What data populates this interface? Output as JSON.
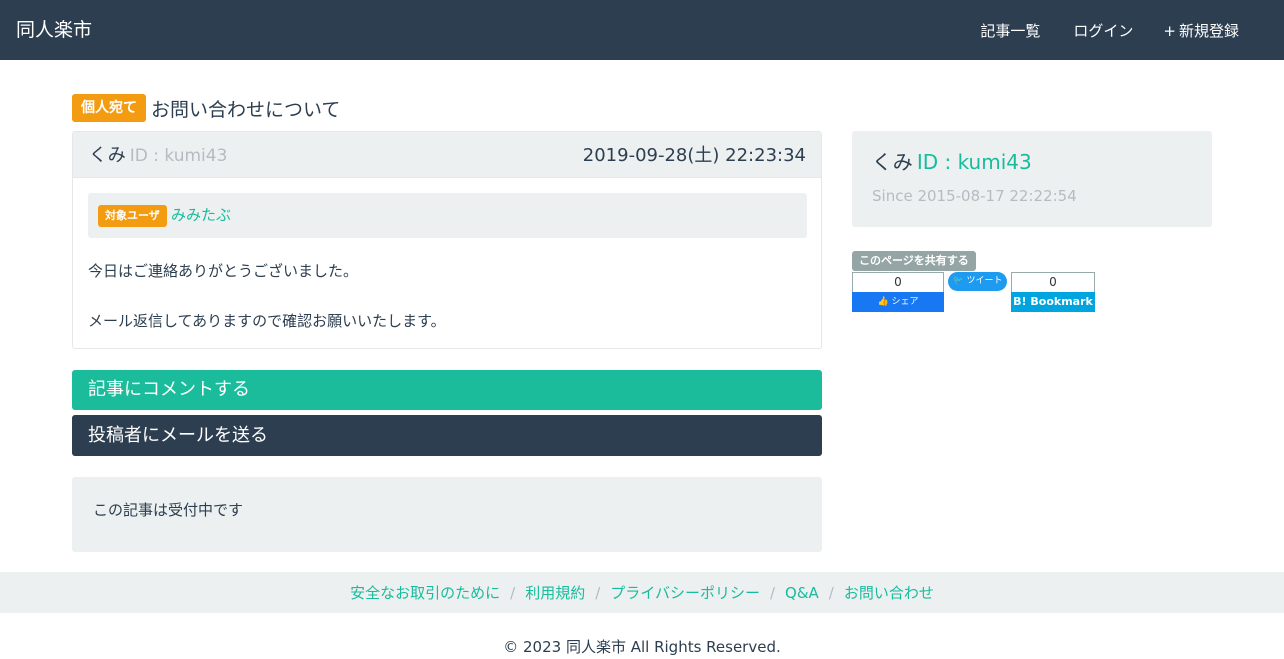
{
  "navbar": {
    "brand": "同人楽市",
    "links": [
      {
        "icon": "list-icon",
        "glyph": "",
        "label": "記事一覧"
      },
      {
        "icon": "login-icon",
        "glyph": "",
        "label": "ログイン"
      },
      {
        "icon": "plus-icon",
        "glyph": "+",
        "label": "新規登録"
      }
    ]
  },
  "article": {
    "badge": "個人宛て",
    "title": "お問い合わせについて",
    "author_icon": "",
    "author_name": "くみ",
    "author_id": "ID : kumi43",
    "date_icon": "",
    "posted_at": "2019-09-28(土) 22:23:34",
    "target_badge": "対象ユーザ",
    "target_name": "みみたぶ",
    "body": [
      "今日はご連絡ありがとうございました。",
      "メール返信してありますので確認お願いいたします。"
    ]
  },
  "actions": {
    "comment": "記事にコメントする",
    "mail": "投稿者にメールを送る"
  },
  "status": "この記事は受付中です",
  "profile": {
    "icon": "",
    "name": "くみ",
    "id": "ID : kumi43",
    "since_icon": "",
    "since": "Since 2015-08-17 22:22:54"
  },
  "share": {
    "label": "このページを共有する",
    "facebook_count": "0",
    "facebook_label": "👍 シェア",
    "twitter_label": "🐦 ツイート",
    "hatena_count": "0",
    "hatena_label": "B! Bookmark"
  },
  "footer": {
    "links": [
      "安全なお取引のために",
      "利用規約",
      "プライバシーポリシー",
      "Q&A",
      "お問い合わせ"
    ],
    "separator": "/",
    "copyright": "© 2023 同人楽市 All Rights Reserved."
  },
  "colors": {
    "navbar": "#2c3e50",
    "accent": "#18bc9c",
    "badge": "#f39c12",
    "panel": "#ecf0f1"
  }
}
